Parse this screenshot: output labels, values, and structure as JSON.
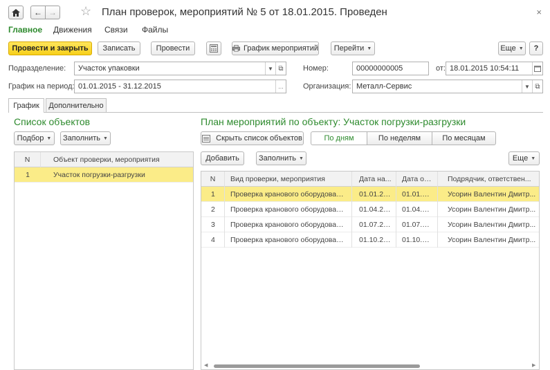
{
  "window": {
    "title": "План проверок, мероприятий № 5 от 18.01.2015. Проведен",
    "close_glyph": "×"
  },
  "sections": [
    {
      "label": "Главное"
    },
    {
      "label": "Движения"
    },
    {
      "label": "Связи"
    },
    {
      "label": "Файлы"
    }
  ],
  "toolbar": {
    "post_close": "Провести и закрыть",
    "write": "Записать",
    "post": "Провести",
    "schedule": "График мероприятий",
    "goto": "Перейти",
    "more": "Еще",
    "help": "?"
  },
  "form": {
    "division_label": "Подразделение:",
    "division_value": "Участок упаковки",
    "number_label": "Номер:",
    "number_value": "00000000005",
    "date_label": "от:",
    "date_value": "18.01.2015 10:54:11",
    "period_label": "График на период:",
    "period_value": "01.01.2015 - 31.12.2015",
    "org_label": "Организация:",
    "org_value": "Металл-Сервис"
  },
  "tabs": [
    {
      "label": "График"
    },
    {
      "label": "Дополнительно"
    }
  ],
  "objects_panel": {
    "title": "Список объектов",
    "pick": "Подбор",
    "fill": "Заполнить",
    "columns": [
      "N",
      "Объект проверки, мероприятия"
    ],
    "rows": [
      {
        "n": "1",
        "name": "Участок погрузки-разгрузки"
      }
    ]
  },
  "events_panel": {
    "title": "План мероприятий по объекту: Участок погрузки-разгрузки",
    "hide_objects": "Скрыть список объектов",
    "by_days": "По дням",
    "by_weeks": "По неделям",
    "by_months": "По месяцам",
    "add": "Добавить",
    "fill": "Заполнить",
    "more": "Еще",
    "columns": [
      "N",
      "Вид проверки, мероприятия",
      "Дата на...",
      "Дата ок...",
      "Подрядчик, ответствен..."
    ],
    "rows": [
      {
        "n": "1",
        "kind": "Проверка кранового оборудования",
        "start": "01.01.20...",
        "end": "01.01.20...",
        "contractor": "Усорин Валентин Дмитр..."
      },
      {
        "n": "2",
        "kind": "Проверка кранового оборудования",
        "start": "01.04.20...",
        "end": "01.04.20...",
        "contractor": "Усорин Валентин Дмитр..."
      },
      {
        "n": "3",
        "kind": "Проверка кранового оборудования",
        "start": "01.07.20...",
        "end": "01.07.20...",
        "contractor": "Усорин Валентин Дмитр..."
      },
      {
        "n": "4",
        "kind": "Проверка кранового оборудования",
        "start": "01.10.20...",
        "end": "01.10.20...",
        "contractor": "Усорин Валентин Дмитр..."
      }
    ]
  },
  "colors": {
    "accent_green": "#2d8a2d",
    "primary_yellow": "#f7cf1a",
    "selected_row": "#fbec88"
  }
}
